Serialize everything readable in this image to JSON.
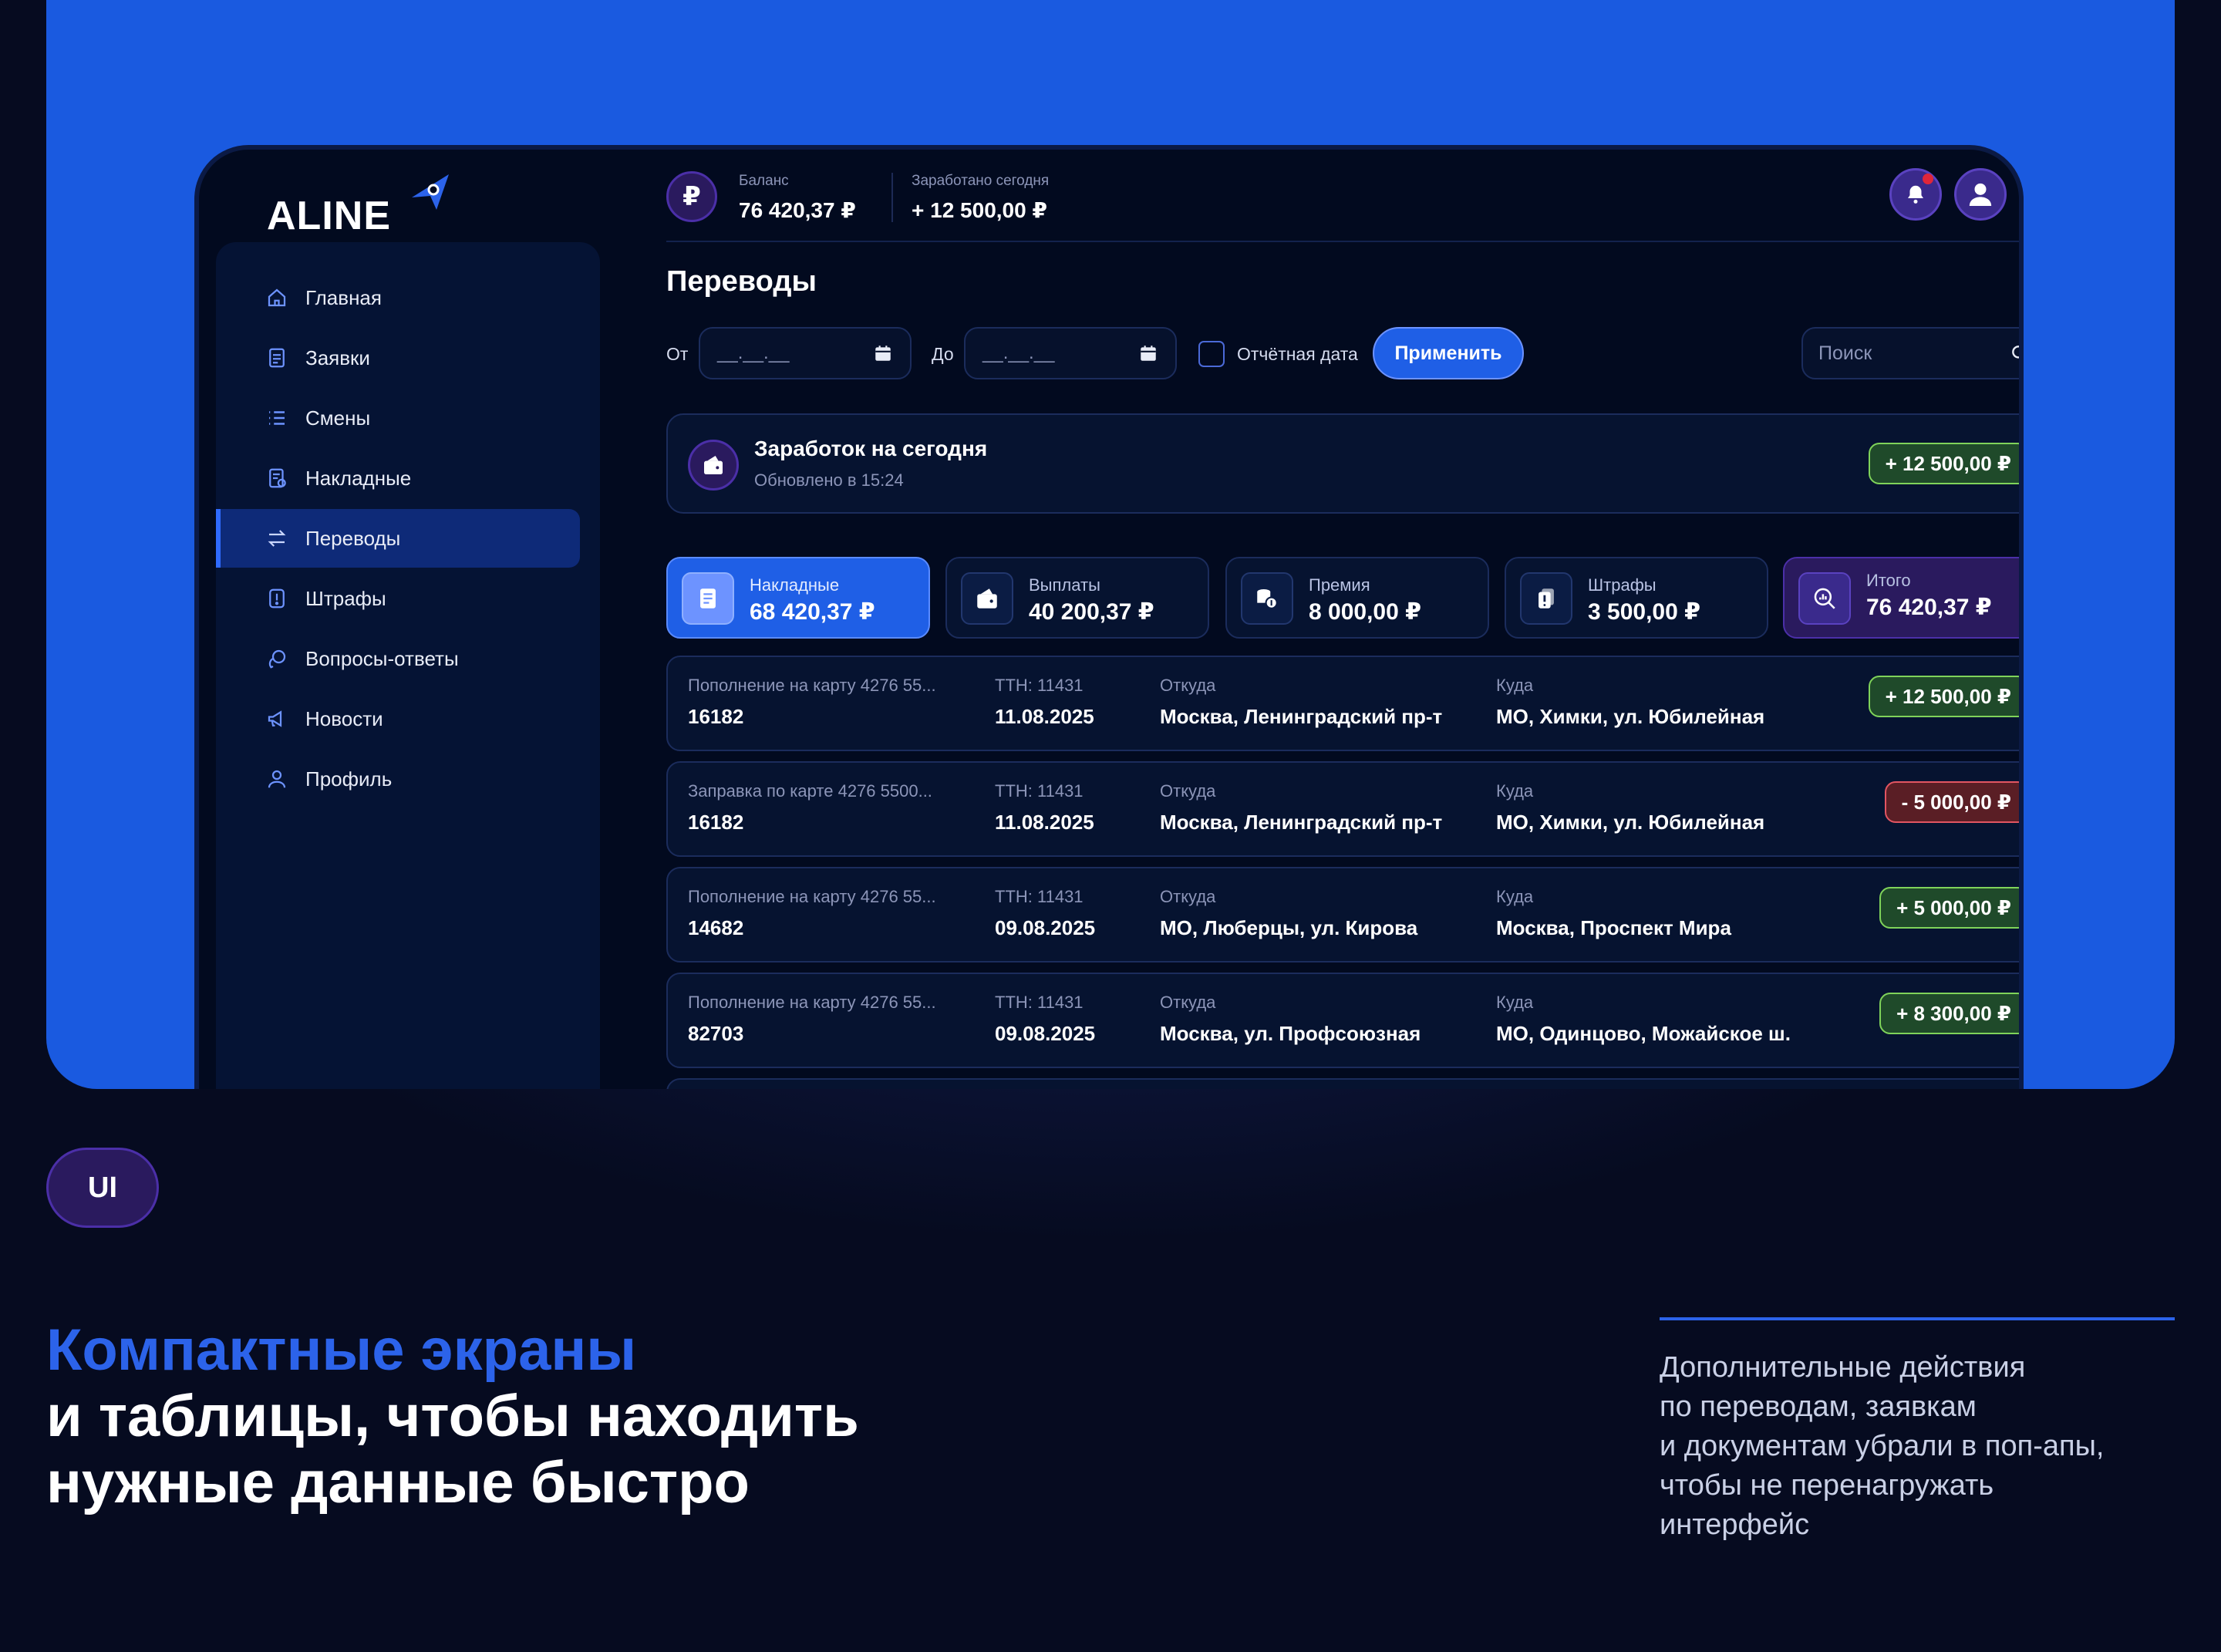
{
  "brand": {
    "logo_text": "ALINE"
  },
  "topbar": {
    "balance_icon": "₽",
    "balance_caption": "Баланс",
    "balance_value": "76 420,37 ₽",
    "earned_caption": "Заработано сегодня",
    "earned_value": "+ 12 500,00 ₽"
  },
  "sidebar": {
    "items": [
      {
        "label": "Главная",
        "icon": "home-icon"
      },
      {
        "label": "Заявки",
        "icon": "document-icon"
      },
      {
        "label": "Смены",
        "icon": "list-icon"
      },
      {
        "label": "Накладные",
        "icon": "invoice-icon"
      },
      {
        "label": "Переводы",
        "icon": "transfer-icon",
        "active": true
      },
      {
        "label": "Штрафы",
        "icon": "warning-icon"
      },
      {
        "label": "Вопросы-ответы",
        "icon": "chat-icon"
      },
      {
        "label": "Новости",
        "icon": "megaphone-icon"
      },
      {
        "label": "Профиль",
        "icon": "user-icon"
      }
    ]
  },
  "main": {
    "title": "Переводы",
    "filters": {
      "from_label": "От",
      "to_label": "До",
      "date_placeholder": "__.__.__",
      "report_date_label": "Отчётная дата",
      "apply_label": "Применить",
      "search_placeholder": "Поиск"
    },
    "today": {
      "title": "Заработок на сегодня",
      "updated": "Обновлено в 15:24",
      "amount": "+ 12 500,00 ₽"
    },
    "kpis": [
      {
        "caption": "Накладные",
        "value": "68 420,37 ₽",
        "icon": "invoice-icon"
      },
      {
        "caption": "Выплаты",
        "value": "40 200,37 ₽",
        "icon": "wallet-icon"
      },
      {
        "caption": "Премия",
        "value": "8 000,00 ₽",
        "icon": "coins-icon"
      },
      {
        "caption": "Штрафы",
        "value": "3 500,00 ₽",
        "icon": "fine-icon"
      },
      {
        "caption": "Итого",
        "value": "76 420,37 ₽",
        "icon": "analytics-icon"
      }
    ],
    "columns": {
      "ttn_prefix": "ТТН: 11431",
      "from": "Откуда",
      "to": "Куда"
    },
    "transfers": [
      {
        "description": "Пополнение на карту 4276 55...",
        "id": "16182",
        "ttn": "ТТН: 11431",
        "date": "11.08.2025",
        "from": "Москва, Ленинградский пр-т",
        "to": "МО, Химки, ул. Юбилейная",
        "amount": "+ 12 500,00 ₽",
        "type": "pos"
      },
      {
        "description": "Заправка по карте 4276 5500...",
        "id": "16182",
        "ttn": "ТТН: 11431",
        "date": "11.08.2025",
        "from": "Москва, Ленинградский пр-т",
        "to": "МО, Химки, ул. Юбилейная",
        "amount": "- 5 000,00 ₽",
        "type": "neg"
      },
      {
        "description": "Пополнение на карту 4276 55...",
        "id": "14682",
        "ttn": "ТТН: 11431",
        "date": "09.08.2025",
        "from": "МО, Люберцы, ул. Кирова",
        "to": "Москва, Проспект Мира",
        "amount": "+ 5 000,00 ₽",
        "type": "pos"
      },
      {
        "description": "Пополнение на карту 4276 55...",
        "id": "82703",
        "ttn": "ТТН: 11431",
        "date": "09.08.2025",
        "from": "Москва, ул. Профсоюзная",
        "to": "МО, Одинцово, Можайское ш.",
        "amount": "+ 8 300,00 ₽",
        "type": "pos"
      }
    ]
  },
  "promo": {
    "tag": "UI",
    "headline_accent": "Компактные экраны",
    "headline_line2": "и таблицы, чтобы находить",
    "headline_line3": "нужные данные быстро",
    "desc_line1": "Дополнительные действия",
    "desc_line2": "по переводам, заявкам",
    "desc_line3": "и документам убрали в поп-апы,",
    "desc_line4": "чтобы не перенагружать",
    "desc_line5": "интерфейс"
  },
  "colors": {
    "background": "#060b20",
    "hero": "#1a5ae0",
    "accent": "#2c63ea",
    "positive": "#7fd35a",
    "negative": "#e25562",
    "purple": "#4b2fa8"
  }
}
